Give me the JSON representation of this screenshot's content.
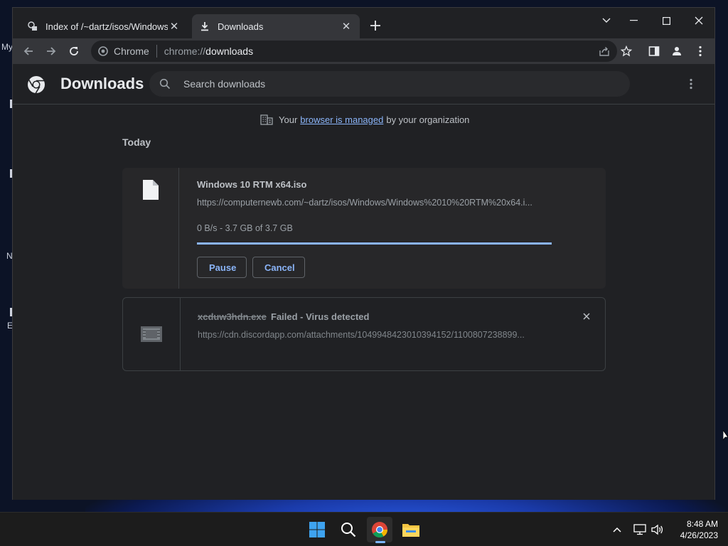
{
  "desktop": {
    "icon_labels": [
      "My",
      "N",
      "E"
    ]
  },
  "browser": {
    "tabs": [
      {
        "title": "Index of /~dartz/isos/Windows/",
        "icon": "page-favicon",
        "active": false
      },
      {
        "title": "Downloads",
        "icon": "download-icon",
        "active": true
      }
    ],
    "omnibox": {
      "chip_label": "Chrome",
      "url_scheme": "chrome://",
      "url_host": "downloads"
    }
  },
  "downloads_page": {
    "title": "Downloads",
    "search_placeholder": "Search downloads",
    "managed": {
      "prefix": "Your",
      "link": "browser is managed",
      "suffix": "by your organization"
    },
    "date_header": "Today",
    "items": [
      {
        "filename": "Windows 10 RTM x64.iso",
        "url": "https://computernewb.com/~dartz/isos/Windows/Windows%2010%20RTM%20x64.i...",
        "status": "0 B/s - 3.7 GB of 3.7 GB",
        "progress": 1.0,
        "icon": "file-icon",
        "pause_label": "Pause",
        "cancel_label": "Cancel"
      },
      {
        "filename": "xcduw3hdn.exe",
        "status": "Failed - Virus detected",
        "url": "https://cdn.discordapp.com/attachments/1049948423010394152/1100807238899...",
        "icon": "exe-file-icon"
      }
    ]
  },
  "taskbar": {
    "time": "8:48 AM",
    "date": "4/26/2023"
  },
  "colors": {
    "accent": "#8ab4f8",
    "page_bg": "#202124",
    "toolbar_bg": "#35363a"
  }
}
